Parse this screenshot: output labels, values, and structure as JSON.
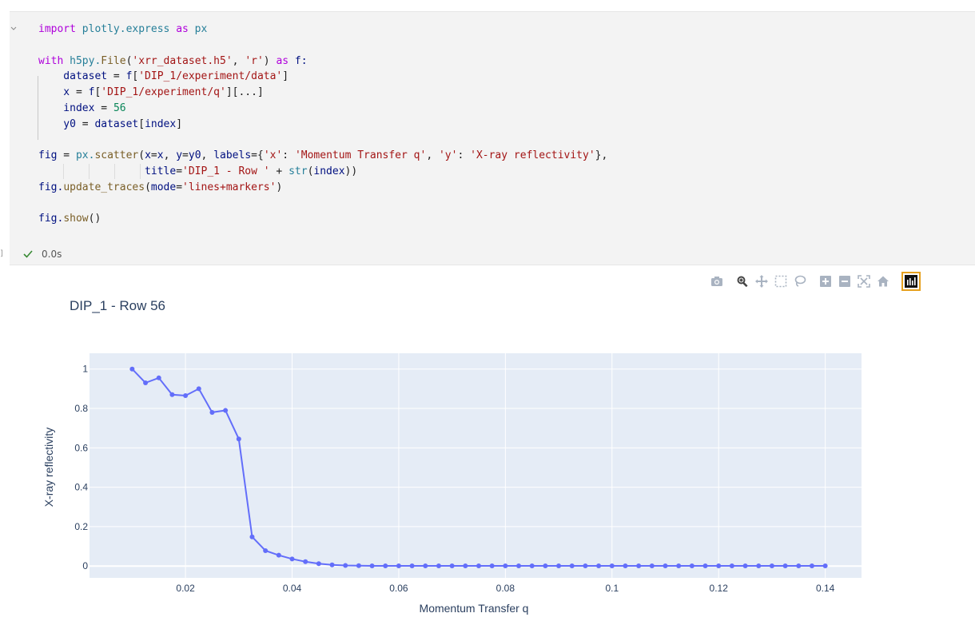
{
  "cell": {
    "code_lines": [
      [
        {
          "t": "import",
          "c": "kw"
        },
        {
          "t": " plotly.express ",
          "c": "mod"
        },
        {
          "t": "as",
          "c": "kw"
        },
        {
          "t": " px",
          "c": "mod"
        }
      ],
      [],
      [
        {
          "t": "with",
          "c": "kw"
        },
        {
          "t": " h5py.",
          "c": "mod"
        },
        {
          "t": "File",
          "c": "fn"
        },
        {
          "t": "(",
          "c": ""
        },
        {
          "t": "'xrr_dataset.h5'",
          "c": "str"
        },
        {
          "t": ", ",
          "c": ""
        },
        {
          "t": "'r'",
          "c": "str"
        },
        {
          "t": ") ",
          "c": ""
        },
        {
          "t": "as",
          "c": "kw"
        },
        {
          "t": " f:",
          "c": "var"
        }
      ],
      [
        {
          "t": "    dataset",
          "c": "var"
        },
        {
          "t": " = ",
          "c": ""
        },
        {
          "t": "f",
          "c": "var"
        },
        {
          "t": "[",
          "c": ""
        },
        {
          "t": "'DIP_1/experiment/data'",
          "c": "str"
        },
        {
          "t": "]",
          "c": ""
        }
      ],
      [
        {
          "t": "    x",
          "c": "var"
        },
        {
          "t": " = ",
          "c": ""
        },
        {
          "t": "f",
          "c": "var"
        },
        {
          "t": "[",
          "c": ""
        },
        {
          "t": "'DIP_1/experiment/q'",
          "c": "str"
        },
        {
          "t": "][...]",
          "c": ""
        }
      ],
      [
        {
          "t": "    index",
          "c": "var"
        },
        {
          "t": " = ",
          "c": ""
        },
        {
          "t": "56",
          "c": "num"
        }
      ],
      [
        {
          "t": "    y0",
          "c": "var"
        },
        {
          "t": " = ",
          "c": ""
        },
        {
          "t": "dataset",
          "c": "var"
        },
        {
          "t": "[",
          "c": ""
        },
        {
          "t": "index",
          "c": "var"
        },
        {
          "t": "]",
          "c": ""
        }
      ],
      [],
      [
        {
          "t": "fig",
          "c": "var"
        },
        {
          "t": " = ",
          "c": ""
        },
        {
          "t": "px.",
          "c": "mod"
        },
        {
          "t": "scatter",
          "c": "fn"
        },
        {
          "t": "(",
          "c": ""
        },
        {
          "t": "x",
          "c": "var"
        },
        {
          "t": "=",
          "c": ""
        },
        {
          "t": "x",
          "c": "var"
        },
        {
          "t": ", ",
          "c": ""
        },
        {
          "t": "y",
          "c": "var"
        },
        {
          "t": "=",
          "c": ""
        },
        {
          "t": "y0",
          "c": "var"
        },
        {
          "t": ", ",
          "c": ""
        },
        {
          "t": "labels",
          "c": "var"
        },
        {
          "t": "={",
          "c": ""
        },
        {
          "t": "'x'",
          "c": "str"
        },
        {
          "t": ": ",
          "c": ""
        },
        {
          "t": "'Momentum Transfer q'",
          "c": "str"
        },
        {
          "t": ", ",
          "c": ""
        },
        {
          "t": "'y'",
          "c": "str"
        },
        {
          "t": ": ",
          "c": ""
        },
        {
          "t": "'X-ray reflectivity'",
          "c": "str"
        },
        {
          "t": "},",
          "c": ""
        }
      ],
      [
        {
          "t": "                 title",
          "c": "var"
        },
        {
          "t": "=",
          "c": ""
        },
        {
          "t": "'DIP_1 - Row '",
          "c": "str"
        },
        {
          "t": " + ",
          "c": ""
        },
        {
          "t": "str",
          "c": "mod"
        },
        {
          "t": "(",
          "c": ""
        },
        {
          "t": "index",
          "c": "var"
        },
        {
          "t": "))",
          "c": ""
        }
      ],
      [
        {
          "t": "fig.",
          "c": "var"
        },
        {
          "t": "update_traces",
          "c": "fn"
        },
        {
          "t": "(",
          "c": ""
        },
        {
          "t": "mode",
          "c": "var"
        },
        {
          "t": "=",
          "c": ""
        },
        {
          "t": "'lines+markers'",
          "c": "str"
        },
        {
          "t": ")",
          "c": ""
        }
      ],
      [],
      [
        {
          "t": "fig.",
          "c": "var"
        },
        {
          "t": "show",
          "c": "fn"
        },
        {
          "t": "()",
          "c": ""
        }
      ]
    ],
    "exec_time": "0.0s",
    "left_marker": "]"
  },
  "toolbar": {
    "buttons": [
      "camera-icon",
      "zoom-icon",
      "pan-icon",
      "box-select-icon",
      "lasso-select-icon",
      "zoom-in-icon",
      "zoom-out-icon",
      "autoscale-icon",
      "reset-axes-icon"
    ],
    "logo": "plotly-logo-icon"
  },
  "colors": {
    "plot_bg": "#e5ecf6",
    "trace": "#636efa",
    "text": "#2a3f5f",
    "accent_logo": "#e6a11f"
  },
  "chart_data": {
    "type": "line",
    "title": "DIP_1 - Row 56",
    "xlabel": "Momentum Transfer q",
    "ylabel": "X-ray reflectivity",
    "xlim": [
      0.002,
      0.1468
    ],
    "ylim": [
      -0.06,
      1.08
    ],
    "xticks": [
      0.02,
      0.04,
      0.06,
      0.08,
      0.1,
      0.12,
      0.14
    ],
    "xtick_labels": [
      "0.02",
      "0.04",
      "0.06",
      "0.08",
      "0.1",
      "0.12",
      "0.14"
    ],
    "yticks": [
      0,
      0.2,
      0.4,
      0.6,
      0.8,
      1
    ],
    "ytick_labels": [
      "0",
      "0.2",
      "0.4",
      "0.6",
      "0.8",
      "1"
    ],
    "grid": true,
    "mode": "lines+markers",
    "x": [
      0.01,
      0.0125,
      0.015,
      0.0175,
      0.02,
      0.0225,
      0.025,
      0.0275,
      0.03,
      0.0325,
      0.035,
      0.0375,
      0.04,
      0.0425,
      0.045,
      0.0475,
      0.05,
      0.0525,
      0.055,
      0.0575,
      0.06,
      0.0625,
      0.065,
      0.0675,
      0.07,
      0.0725,
      0.075,
      0.0775,
      0.08,
      0.0825,
      0.085,
      0.0875,
      0.09,
      0.0925,
      0.095,
      0.0975,
      0.1,
      0.1025,
      0.105,
      0.1075,
      0.11,
      0.1125,
      0.115,
      0.1175,
      0.12,
      0.1225,
      0.125,
      0.1275,
      0.13,
      0.1325,
      0.135,
      0.1375,
      0.14
    ],
    "y": [
      1.0,
      0.93,
      0.955,
      0.87,
      0.865,
      0.9,
      0.78,
      0.79,
      0.645,
      0.148,
      0.078,
      0.055,
      0.036,
      0.022,
      0.012,
      0.006,
      0.003,
      0.002,
      0.001,
      0.001,
      0.001,
      0.001,
      0.001,
      0.001,
      0.001,
      0.001,
      0.001,
      0.001,
      0.001,
      0.001,
      0.001,
      0.001,
      0.001,
      0.001,
      0.001,
      0.001,
      0.001,
      0.001,
      0.001,
      0.001,
      0.001,
      0.001,
      0.001,
      0.001,
      0.001,
      0.001,
      0.001,
      0.001,
      0.001,
      0.001,
      0.001,
      0.001,
      0.001
    ]
  }
}
